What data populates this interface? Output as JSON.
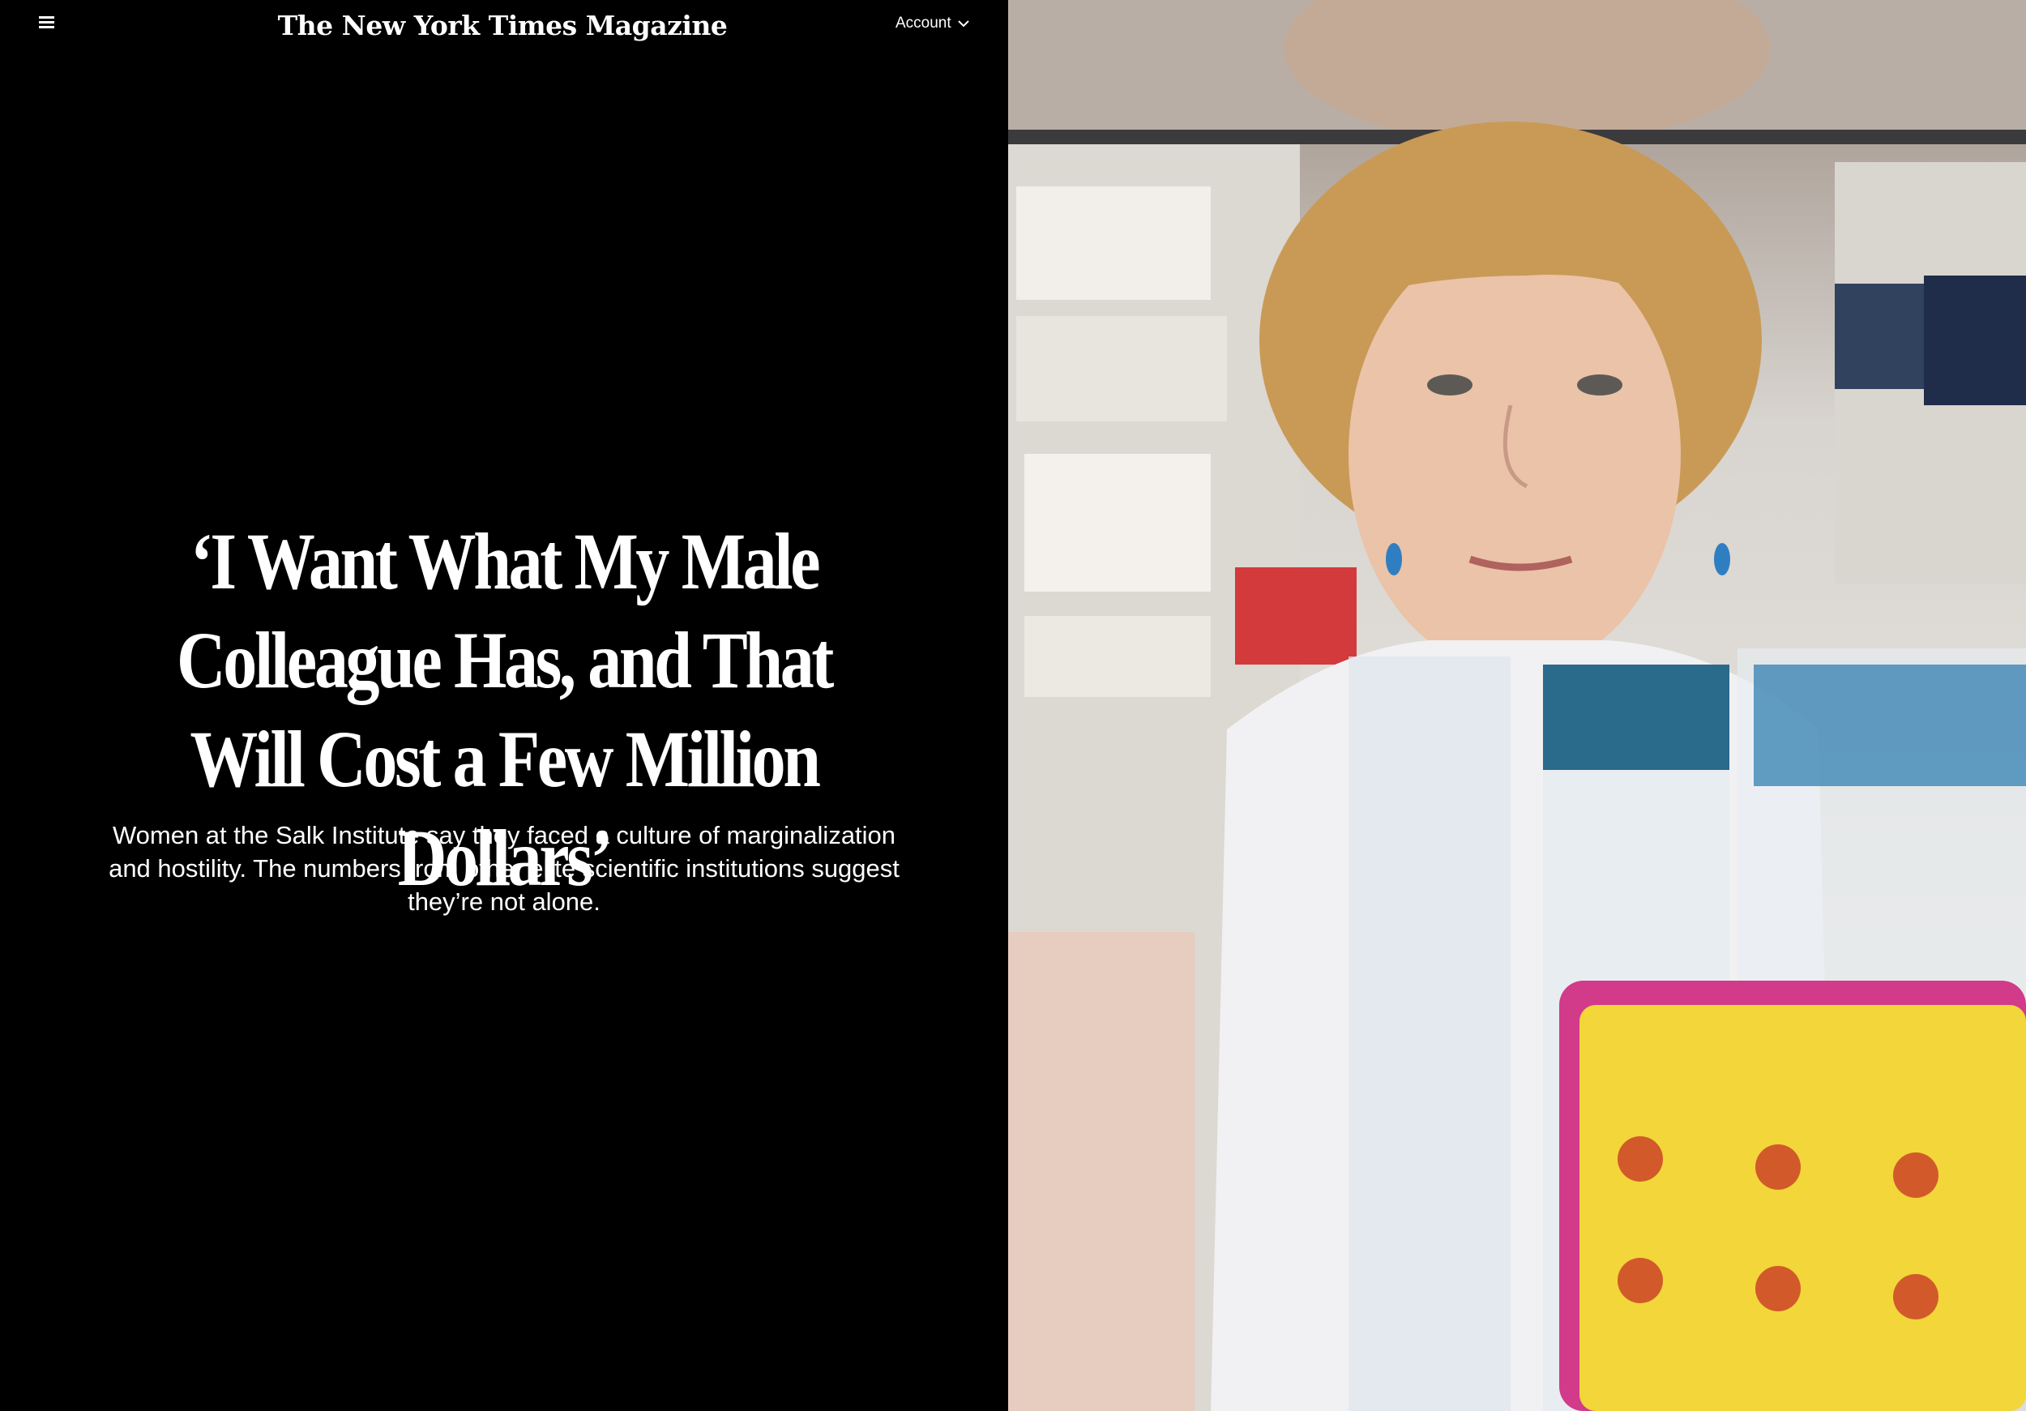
{
  "header": {
    "masthead": "The New York Times Magazine",
    "account_label": "Account",
    "menu_icon": "hamburger-menu-icon",
    "account_icon": "chevron-down-icon"
  },
  "article": {
    "headline": "‘I Want What My Male Colleague Has, and That Will Cost a Few Million Dollars’",
    "dek": "Women at the Salk Institute say they faced a culture of marginalization and hostility. The numbers from other elite scientific institutions suggest they’re not alone."
  },
  "colors": {
    "background": "#000000",
    "text": "#ffffff"
  }
}
